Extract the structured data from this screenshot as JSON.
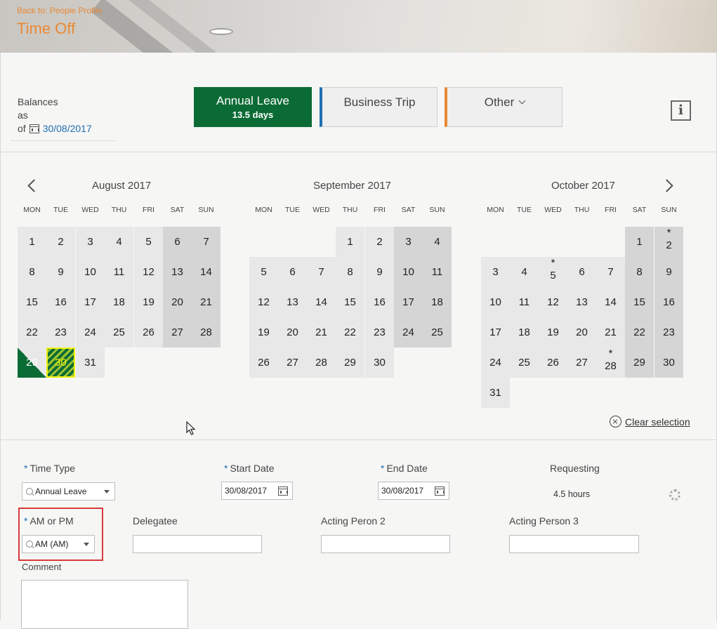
{
  "header": {
    "back_link": "Back to: People Profile",
    "title": "Time Off"
  },
  "balances": {
    "line1": "Balances",
    "line2": "as",
    "line3": "of",
    "date": "30/08/2017"
  },
  "tabs": {
    "annual": {
      "label": "Annual Leave",
      "sub": "13.5 days"
    },
    "business": {
      "label": "Business Trip"
    },
    "other": {
      "label": "Other"
    }
  },
  "info_icon_glyph": "i",
  "calendar": {
    "dow": [
      "MON",
      "TUE",
      "WED",
      "THU",
      "FRI",
      "SAT",
      "SUN"
    ],
    "months": [
      {
        "title": "August 2017",
        "first_weekday": 1,
        "days": 31,
        "holidays": [],
        "half_day": [
          29
        ],
        "selected": [
          30
        ]
      },
      {
        "title": "September 2017",
        "first_weekday": 4,
        "days": 30,
        "holidays": [],
        "half_day": [],
        "selected": []
      },
      {
        "title": "October 2017",
        "first_weekday": 6,
        "days": 31,
        "holidays": [
          2,
          5,
          28
        ],
        "half_day": [],
        "selected": []
      }
    ],
    "clear_selection": "Clear selection"
  },
  "form": {
    "time_type": {
      "label": "Time Type",
      "value": "Annual Leave"
    },
    "start_date": {
      "label": "Start Date",
      "value": "30/08/2017"
    },
    "end_date": {
      "label": "End Date",
      "value": "30/08/2017"
    },
    "requesting": {
      "label": "Requesting",
      "value": "4.5 hours"
    },
    "am_pm": {
      "label": "AM or PM",
      "value": "AM (AM)"
    },
    "delegatee": {
      "label": "Delegatee",
      "value": ""
    },
    "acting2": {
      "label": "Acting Peron 2",
      "value": ""
    },
    "acting3": {
      "label": "Acting Person 3",
      "value": ""
    },
    "comment": {
      "label": "Comment",
      "value": ""
    }
  },
  "colors": {
    "accent": "#e98933",
    "leave_green": "#0b6b35",
    "link_blue": "#1f6fb2",
    "highlight_red": "#d9393a"
  }
}
